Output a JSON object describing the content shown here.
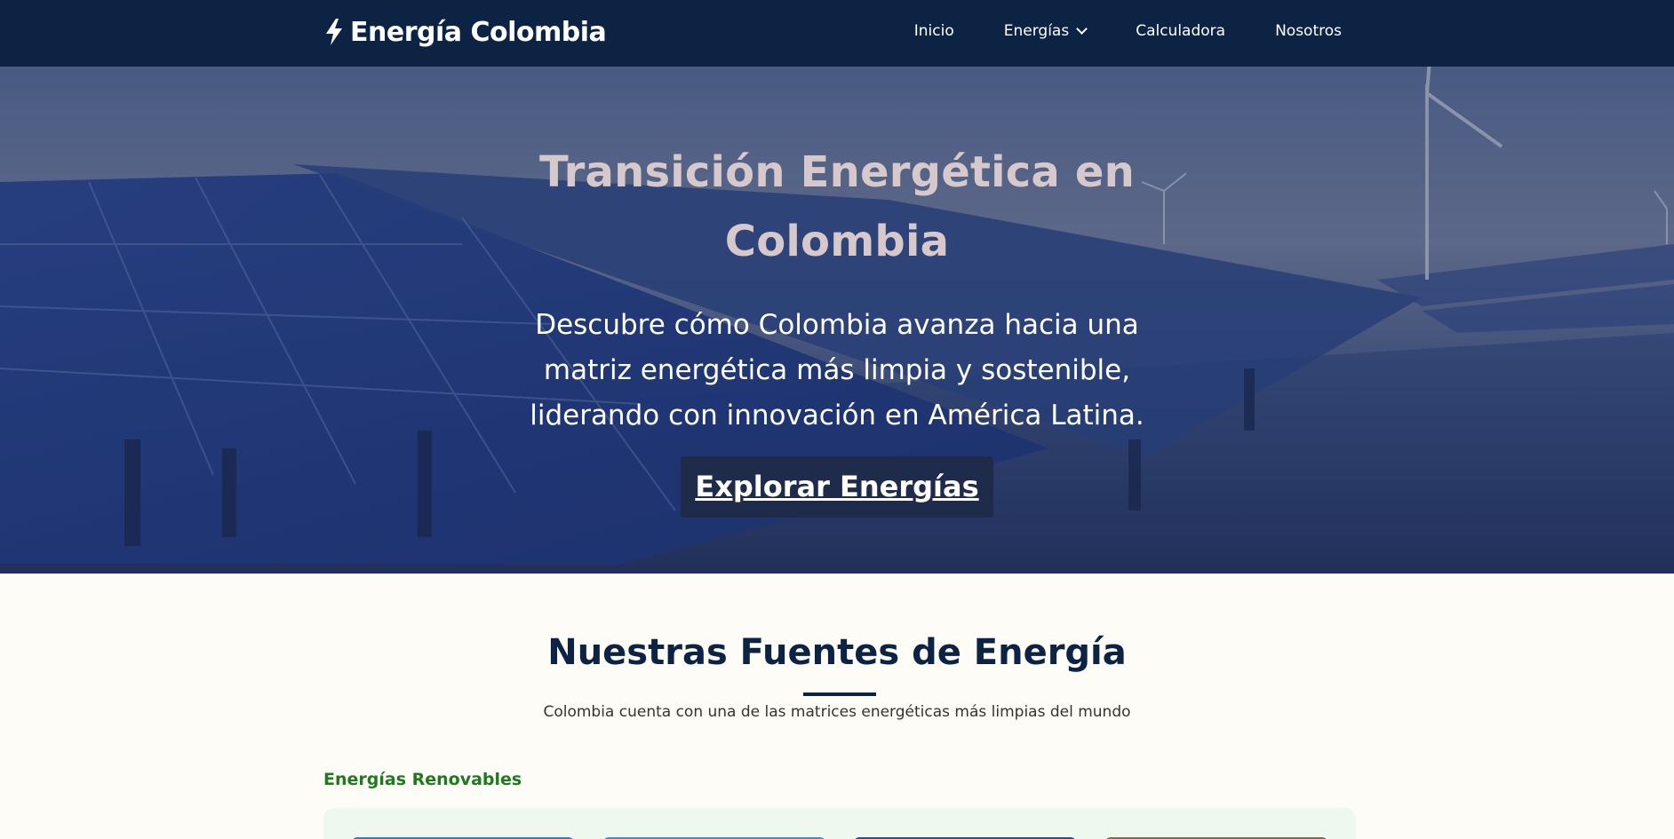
{
  "navbar": {
    "brand": "Energía Colombia",
    "brand_icon": "bolt-icon",
    "items": [
      {
        "label": "Inicio"
      },
      {
        "label": "Energías",
        "icon": "chevron-down-icon"
      },
      {
        "label": "Calculadora"
      },
      {
        "label": "Nosotros"
      }
    ]
  },
  "hero": {
    "title": "Transición Energética en Colombia",
    "text": "Descubre cómo Colombia avanza hacia una matriz energética más limpia y sostenible, liderando con innovación en América Latina.",
    "button": "Explorar Energías"
  },
  "section": {
    "title": "Nuestras Fuentes de Energía",
    "subtitle": "Colombia cuenta con una de las matrices energéticas más limpias del mundo",
    "group_title": "Energías Renovables"
  },
  "colors": {
    "navy": "#0c2344",
    "background": "#fdfcf7",
    "accent_green": "#1e7a1e",
    "hero_title": "#d7c8cc",
    "button_bg": "#1e2b4b"
  }
}
